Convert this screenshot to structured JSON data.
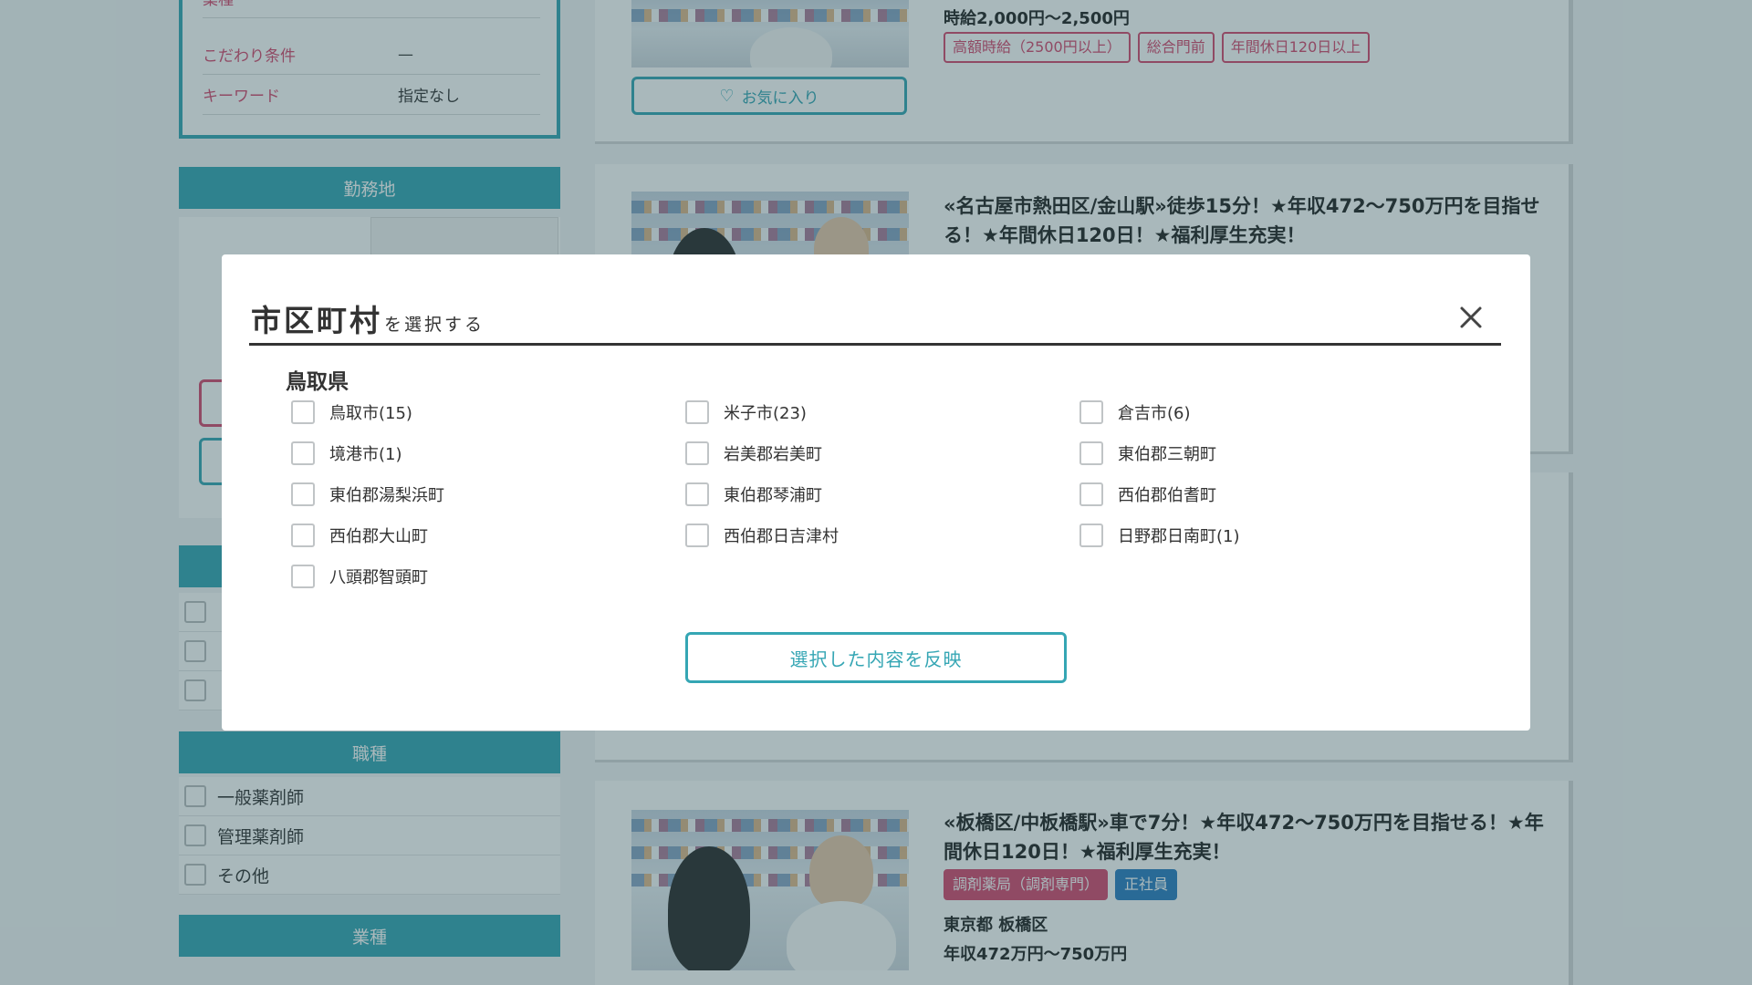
{
  "sidebar": {
    "summary": [
      {
        "label": "業種",
        "value": "—"
      },
      {
        "label": "こだわり条件",
        "value": "—"
      },
      {
        "label": "キーワード",
        "value": "指定なし"
      }
    ],
    "location_header": "勤務地",
    "job_type_header": "職種",
    "job_types": [
      "一般薬剤師",
      "管理薬剤師",
      "その他"
    ],
    "industry_header": "業種"
  },
  "results": {
    "card1": {
      "salary": "時給2,000円〜2,500円",
      "tags": [
        "高額時給（2500円以上）",
        "総合門前",
        "年間休日120日以上"
      ],
      "favorite_label": "お気に入り"
    },
    "card2": {
      "title": "«名古屋市熱田区/金山駅»徒歩15分！★年収472〜750万円を目指せる！★年間休日120日！★福利厚生充実！"
    },
    "card4": {
      "title": "«板橋区/中板橋駅»車で7分！★年収472〜750万円を目指せる！★年間休日120日！★福利厚生充実！",
      "tags": [
        "調剤薬局（調剤専門）",
        "正社員"
      ],
      "location": "東京都 板橋区",
      "salary": "年収472万円〜750万円"
    }
  },
  "modal": {
    "title": "市区町村",
    "subtitle": "を選択する",
    "prefecture": "鳥取県",
    "towns": [
      "鳥取市(15)",
      "米子市(23)",
      "倉吉市(6)",
      "境港市(1)",
      "岩美郡岩美町",
      "東伯郡三朝町",
      "東伯郡湯梨浜町",
      "東伯郡琴浦町",
      "西伯郡伯耆町",
      "西伯郡大山町",
      "西伯郡日吉津村",
      "日野郡日南町(1)",
      "八頭郡智頭町"
    ],
    "apply_label": "選択した内容を反映",
    "close_icon": "close-icon"
  },
  "colors": {
    "accent": "#35a6b4",
    "pink": "#d6486e",
    "blue": "#2b7ec2"
  }
}
